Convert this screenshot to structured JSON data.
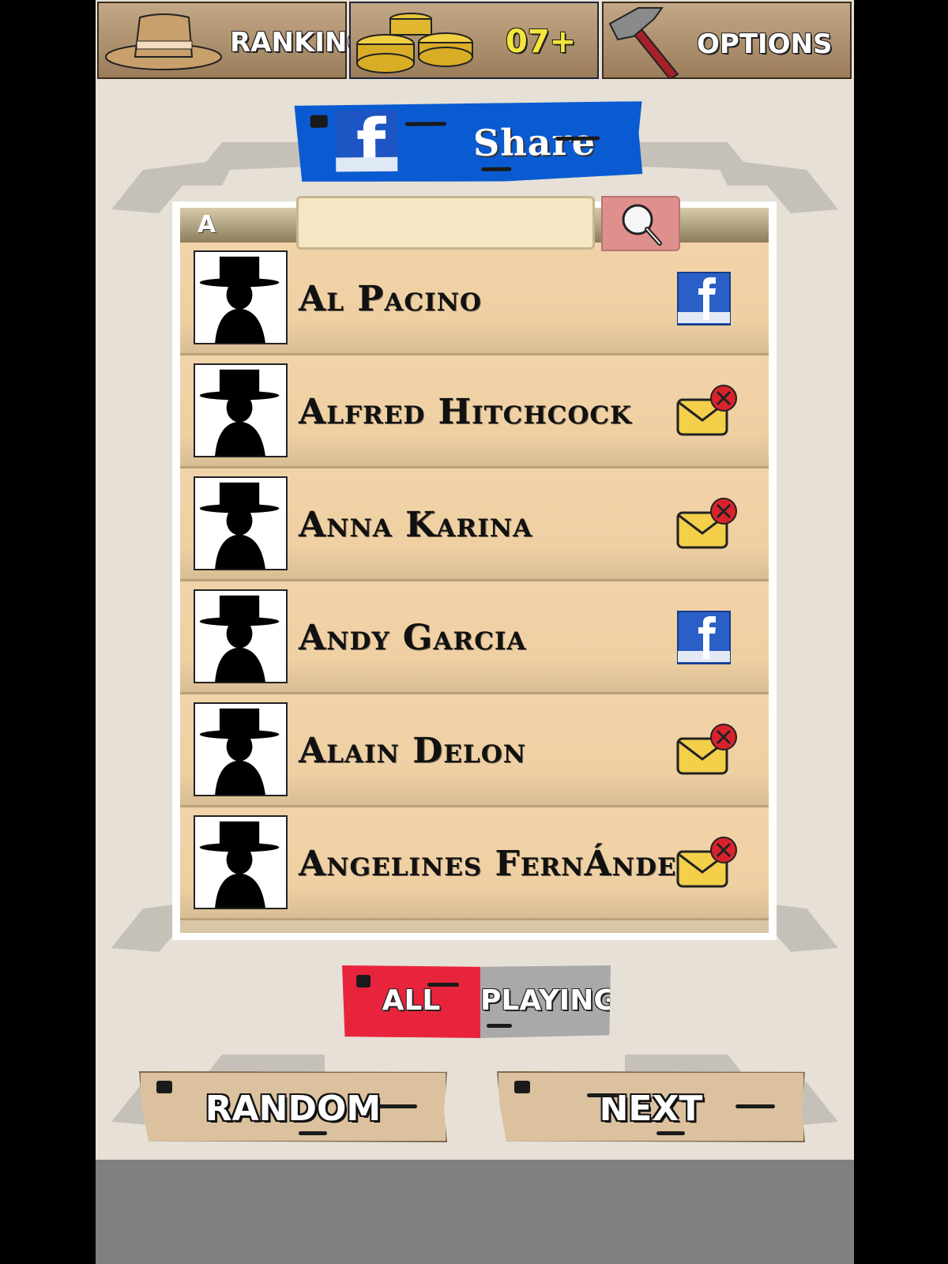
{
  "topbar": {
    "ranking_label": "RANKING",
    "coins_label": "07+",
    "options_label": "OPTIONS"
  },
  "share": {
    "label": "Share",
    "icon": "facebook-icon"
  },
  "search": {
    "letter": "A",
    "value": "",
    "placeholder": ""
  },
  "friends": [
    {
      "name": "Al Pacino",
      "status": "facebook"
    },
    {
      "name": "Alfred Hitchcock",
      "status": "mail"
    },
    {
      "name": "Anna Karina",
      "status": "mail"
    },
    {
      "name": "Andy Garcia",
      "status": "facebook"
    },
    {
      "name": "Alain Delon",
      "status": "mail"
    },
    {
      "name": "Angelines FernÁndez",
      "status": "mail"
    }
  ],
  "filter": {
    "all_label": "ALL",
    "playing_label": "PLAYING",
    "selected": "ALL"
  },
  "actions": {
    "random_label": "RANDOM",
    "next_label": "NEXT"
  },
  "colors": {
    "facebook": "#0a5bd1",
    "all_active": "#e8243c",
    "playing_inactive": "#a9a9a9",
    "coins": "#f4e63a"
  }
}
